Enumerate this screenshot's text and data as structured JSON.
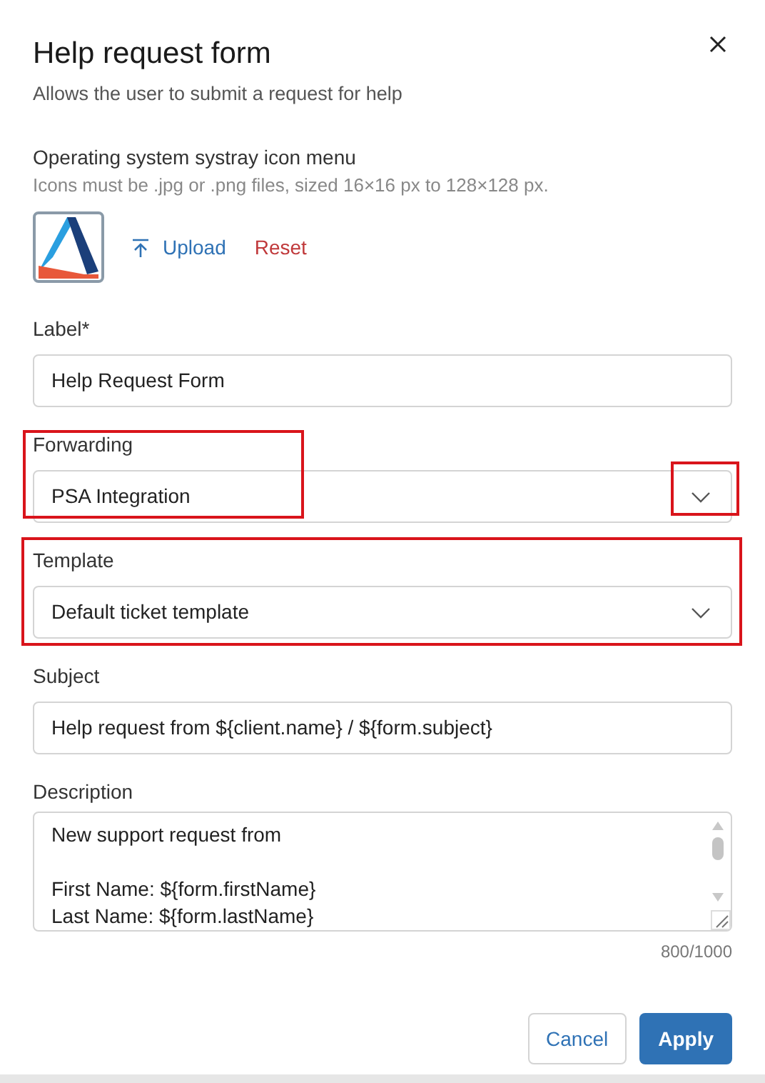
{
  "dialog": {
    "title": "Help request form",
    "subtitle": "Allows the user to submit a request for help"
  },
  "icon_section": {
    "title": "Operating system systray icon menu",
    "hint": "Icons must be .jpg or .png files, sized 16×16 px to 128×128 px.",
    "upload": "Upload",
    "reset": "Reset"
  },
  "fields": [
    {
      "kind": "input",
      "label": "Label*",
      "value": "Help Request Form"
    },
    {
      "kind": "select",
      "label": "Forwarding",
      "value": "PSA Integration"
    },
    {
      "kind": "select",
      "label": "Template",
      "value": "Default ticket template"
    },
    {
      "kind": "input",
      "label": "Subject",
      "value": "Help request from ${client.name} / ${form.subject}"
    },
    {
      "kind": "textarea",
      "label": "Description",
      "value": "New support request from\n\nFirst Name: ${form.firstName}\nLast Name: ${form.lastName}",
      "counter": "800/1000"
    }
  ],
  "buttons": [
    {
      "label": "Cancel",
      "kind": "secondary"
    },
    {
      "label": "Apply",
      "kind": "primary"
    }
  ]
}
